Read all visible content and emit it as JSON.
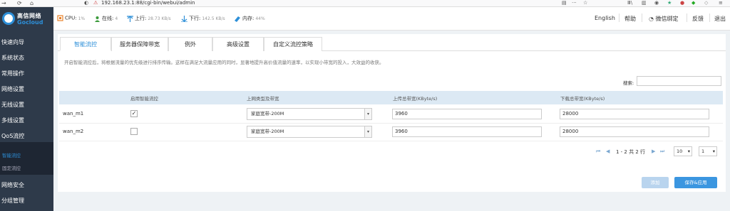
{
  "browser": {
    "url": "192.168.23.1:88/cgi-bin/webui/admin"
  },
  "logo": {
    "cn": "高信网络",
    "en": "Gocloud"
  },
  "status": {
    "cpu_label": "CPU:",
    "cpu_value": "1%",
    "online_label": "在线:",
    "online_value": "4",
    "up_label": "上行:",
    "up_value": "28.73 KB/s",
    "down_label": "下行:",
    "down_value": "142.5 KB/s",
    "mem_label": "内存:",
    "mem_value": "44%"
  },
  "topnav": {
    "lang": "English",
    "help": "帮助",
    "wechat": "微信绑定",
    "feedback": "反馈",
    "logout": "退出"
  },
  "sidebar": {
    "items": [
      "快速向导",
      "系统状态",
      "常用操作",
      "网络设置",
      "无线设置",
      "多线设置",
      "QoS流控"
    ],
    "sub": [
      "智能流控",
      "固定流控"
    ],
    "bottom": [
      "网络安全",
      "分组管理"
    ]
  },
  "tabs": [
    "智能流控",
    "服务器保障带宽",
    "例外",
    "高级设置",
    "自定义流控策略"
  ],
  "description": "开启智能流控后，将根据流量的优先级进行排序传输。这样在满足大流量应用的同时，显著地提升高价值流量的速率，以实现小带宽的投入，大效益的收获。",
  "search": {
    "label": "搜索:"
  },
  "table": {
    "headers": [
      "启用智能流控",
      "上网类型及带宽",
      "上传总带宽(KByte/s)",
      "下载总带宽(KByte/s)"
    ],
    "rows": [
      {
        "name": "wan_m1",
        "enabled": true,
        "type": "家庭宽带-200M",
        "up": "3960",
        "down": "28000"
      },
      {
        "name": "wan_m2",
        "enabled": false,
        "type": "家庭宽带-200M",
        "up": "3960",
        "down": "28000"
      }
    ]
  },
  "pager": {
    "info": "1 - 2 共 2 行",
    "page_size": "10",
    "page": "1"
  },
  "buttons": {
    "add": "添加",
    "save": "保存&应用"
  },
  "colors": {
    "sidebar": "#2e3a4a",
    "accent": "#2d8fd8",
    "header_row": "#dce9f4"
  }
}
